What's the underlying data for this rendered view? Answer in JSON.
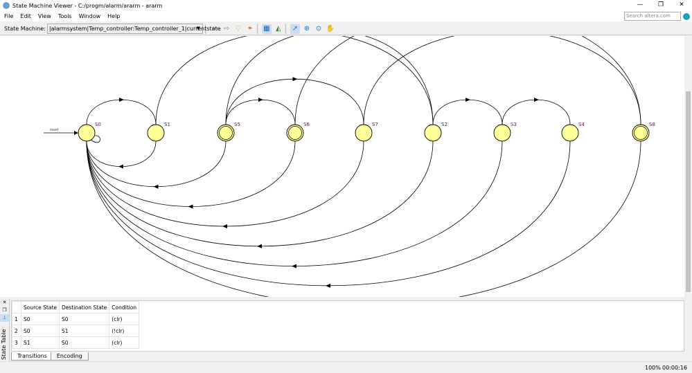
{
  "window": {
    "title": "State Machine Viewer - C:/progm/alarm/ararm - ararm",
    "minimize": "—",
    "maximize": "❐",
    "close": "✕"
  },
  "menu": [
    "File",
    "Edit",
    "View",
    "Tools",
    "Window",
    "Help"
  ],
  "search": {
    "placeholder": "Search altera.com"
  },
  "toolbar": {
    "label": "State Machine:",
    "selected": "|alarmsystem|Temp_controller:Temp_controller_1|currentstate"
  },
  "diagram": {
    "reset_label": "reset",
    "states": [
      {
        "name": "S0",
        "double": false
      },
      {
        "name": "S1",
        "double": false
      },
      {
        "name": "S5",
        "double": true
      },
      {
        "name": "S6",
        "double": true
      },
      {
        "name": "S7",
        "double": false
      },
      {
        "name": "S2",
        "double": false
      },
      {
        "name": "S3",
        "double": false
      },
      {
        "name": "S4",
        "double": false
      },
      {
        "name": "S8",
        "double": true
      }
    ],
    "transitions": [
      {
        "from": "S0",
        "to": "S0"
      },
      {
        "from": "S0",
        "to": "S1"
      },
      {
        "from": "S1",
        "to": "S0"
      },
      {
        "from": "S1",
        "to": "S2"
      },
      {
        "from": "S5",
        "to": "S6"
      },
      {
        "from": "S5",
        "to": "S7"
      },
      {
        "from": "S6",
        "to": "S8"
      },
      {
        "from": "S7",
        "to": "S8"
      },
      {
        "from": "S2",
        "to": "S3"
      },
      {
        "from": "S3",
        "to": "S4"
      },
      {
        "from": "S5",
        "to": "S0"
      },
      {
        "from": "S6",
        "to": "S0"
      },
      {
        "from": "S7",
        "to": "S0"
      },
      {
        "from": "S2",
        "to": "S0"
      },
      {
        "from": "S3",
        "to": "S0"
      },
      {
        "from": "S4",
        "to": "S0"
      },
      {
        "from": "S8",
        "to": "S0"
      },
      {
        "from": "S5",
        "to": "S2"
      }
    ]
  },
  "state_table": {
    "side_label": "State Table",
    "columns": [
      "",
      "Source State",
      "Destination State",
      "Condition"
    ],
    "rows": [
      [
        "1",
        "S0",
        "S0",
        "(clr)"
      ],
      [
        "2",
        "S0",
        "S1",
        "(!clr)"
      ],
      [
        "3",
        "S1",
        "S0",
        "(clr)"
      ]
    ],
    "tabs": [
      "Transitions",
      "Encoding"
    ]
  },
  "status": {
    "zoom": "100%",
    "time": "00:00:16"
  }
}
